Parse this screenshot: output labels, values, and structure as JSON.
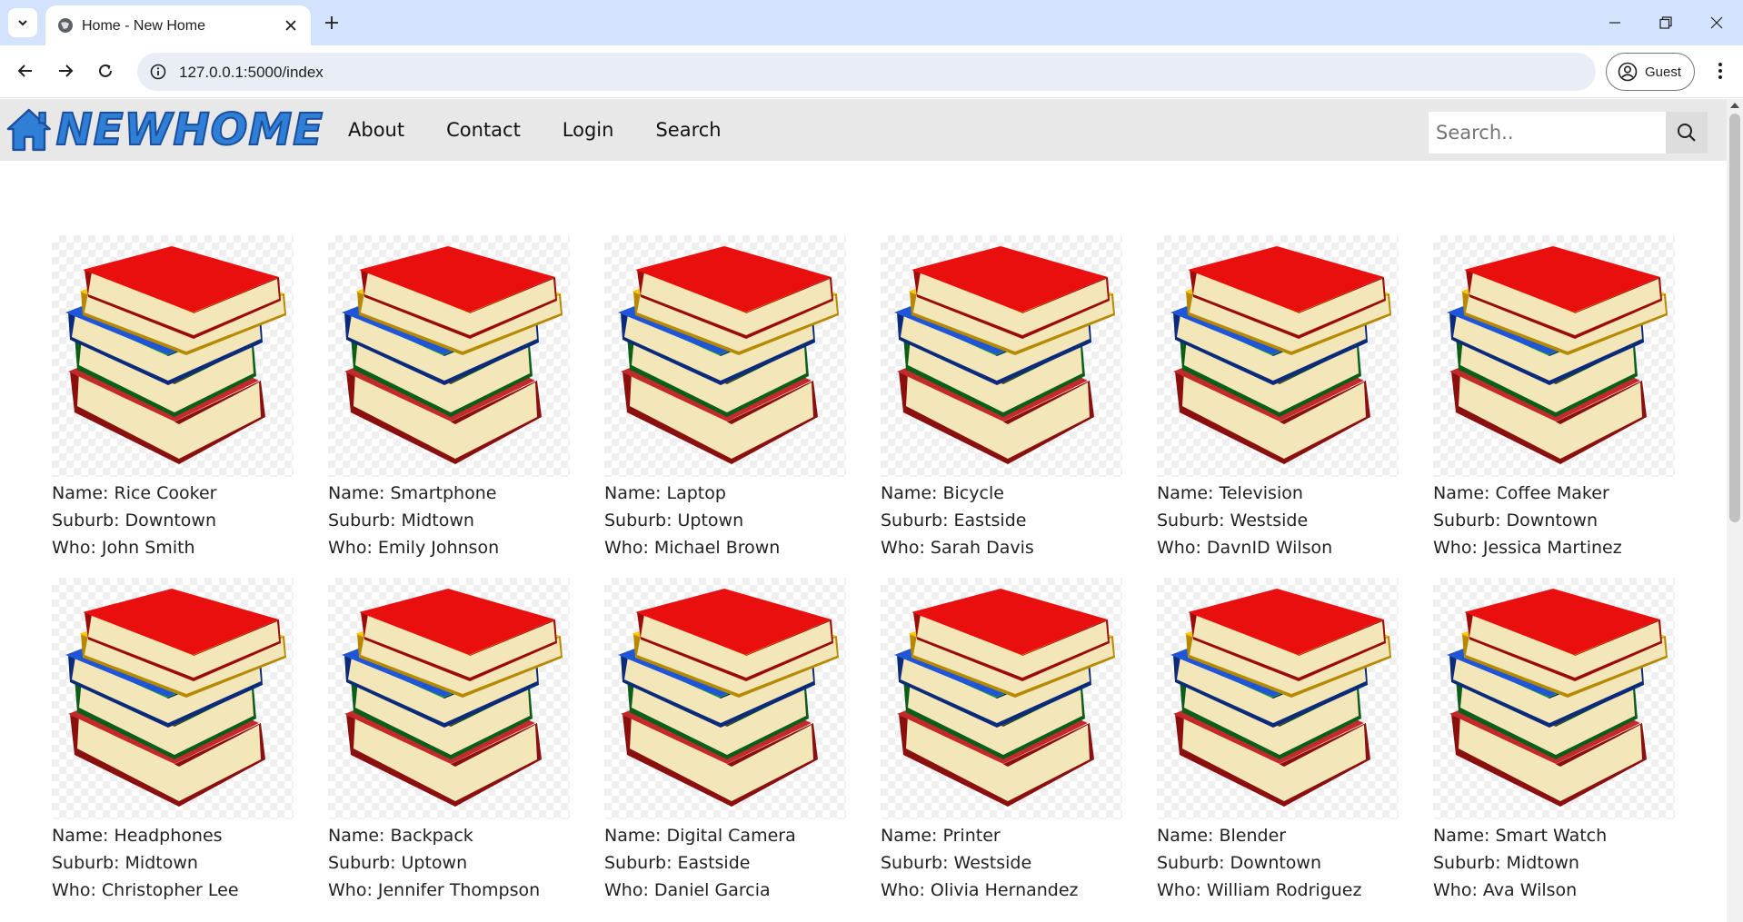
{
  "browser": {
    "tab_title": "Home - New Home",
    "url": "127.0.0.1:5000/index",
    "profile_label": "Guest"
  },
  "site": {
    "logo_text": "NEWHOME",
    "nav": [
      "About",
      "Contact",
      "Login",
      "Search"
    ],
    "search_placeholder": "Search.."
  },
  "listings": [
    {
      "name": "Name: Rice Cooker",
      "suburb": "Suburb: Downtown",
      "who": "Who: John Smith"
    },
    {
      "name": "Name: Smartphone",
      "suburb": "Suburb: Midtown",
      "who": "Who: Emily Johnson"
    },
    {
      "name": "Name: Laptop",
      "suburb": "Suburb: Uptown",
      "who": "Who: Michael Brown"
    },
    {
      "name": "Name: Bicycle",
      "suburb": "Suburb: Eastside",
      "who": "Who: Sarah Davis"
    },
    {
      "name": "Name: Television",
      "suburb": "Suburb: Westside",
      "who": "Who: DavnID Wilson"
    },
    {
      "name": "Name: Coffee Maker",
      "suburb": "Suburb: Downtown",
      "who": "Who: Jessica Martinez"
    },
    {
      "name": "Name: Headphones",
      "suburb": "Suburb: Midtown",
      "who": "Who: Christopher Lee"
    },
    {
      "name": "Name: Backpack",
      "suburb": "Suburb: Uptown",
      "who": "Who: Jennifer Thompson"
    },
    {
      "name": "Name: Digital Camera",
      "suburb": "Suburb: Eastside",
      "who": "Who: Daniel Garcia"
    },
    {
      "name": "Name: Printer",
      "suburb": "Suburb: Westside",
      "who": "Who: Olivia Hernandez"
    },
    {
      "name": "Name: Blender",
      "suburb": "Suburb: Downtown",
      "who": "Who: William Rodriguez"
    },
    {
      "name": "Name: Smart Watch",
      "suburb": "Suburb: Midtown",
      "who": "Who: Ava Wilson"
    }
  ],
  "colors": {
    "tabstrip": "#d3e3fd",
    "navbar": "#e8e8e8",
    "logo": "#2f7fd7"
  }
}
